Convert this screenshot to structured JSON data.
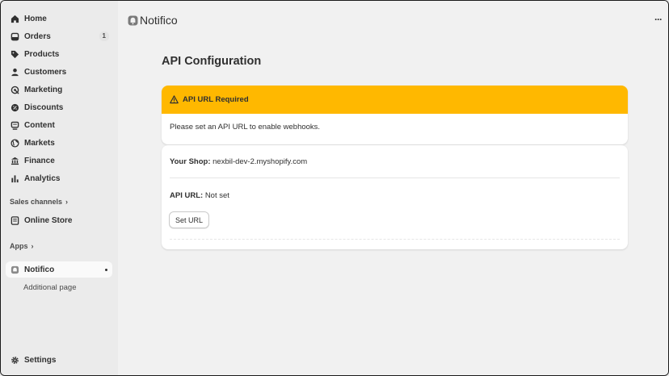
{
  "sidebar": {
    "items": [
      {
        "label": "Home",
        "icon": "home-icon"
      },
      {
        "label": "Orders",
        "icon": "orders-icon",
        "count": "1"
      },
      {
        "label": "Products",
        "icon": "tag-icon"
      },
      {
        "label": "Customers",
        "icon": "person-icon"
      },
      {
        "label": "Marketing",
        "icon": "target-icon"
      },
      {
        "label": "Discounts",
        "icon": "discount-icon"
      },
      {
        "label": "Content",
        "icon": "content-icon"
      },
      {
        "label": "Markets",
        "icon": "globe-icon"
      },
      {
        "label": "Finance",
        "icon": "bank-icon"
      },
      {
        "label": "Analytics",
        "icon": "bar-chart-icon"
      }
    ],
    "sales_channels_label": "Sales channels",
    "online_store_label": "Online Store",
    "apps_label": "Apps",
    "app_name": "Notifico",
    "app_subpage": "Additional page",
    "settings_label": "Settings"
  },
  "header": {
    "app_title": "Notifico",
    "more_label": "···"
  },
  "main": {
    "page_title": "API Configuration",
    "banner": {
      "title": "API URL Required",
      "message": "Please set an API URL to enable webhooks.",
      "color": "#ffb800"
    },
    "card": {
      "shop_label": "Your Shop:",
      "shop_value": "nexbil-dev-2.myshopify.com",
      "api_label": "API URL:",
      "api_value": "Not set",
      "button_label": "Set URL"
    }
  }
}
